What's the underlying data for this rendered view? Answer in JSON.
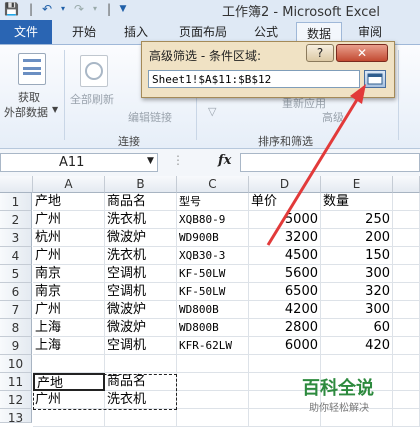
{
  "window": {
    "title": "工作簿2 - Microsoft Excel"
  },
  "quick_access": {
    "icons": [
      "save-icon",
      "undo-icon",
      "redo-icon",
      "customize-icon"
    ]
  },
  "ribbon": {
    "tabs": [
      "文件",
      "开始",
      "插入",
      "页面布局",
      "公式",
      "数据",
      "审阅"
    ],
    "active_tab": "数据",
    "get_external_data": {
      "line1": "获取",
      "line2": "外部数据"
    },
    "refresh_all": "全部刷新",
    "edit_links": "编辑链接",
    "group_connections": "连接",
    "group_sort_filter": "排序和筛选",
    "reapply": "重新应用",
    "advanced": "高级"
  },
  "dialog": {
    "title": "高级筛选 - 条件区域:",
    "help": "?",
    "close": "✕",
    "value": "Sheet1!$A$11:$B$12"
  },
  "formula_bar": {
    "name_box": "A11",
    "fx": "fx",
    "formula": ""
  },
  "sheet": {
    "columns": [
      "A",
      "B",
      "C",
      "D",
      "E"
    ],
    "rows": [
      [
        "产地",
        "商品名",
        "型号",
        "单价",
        "数量"
      ],
      [
        "广州",
        "洗衣机",
        "XQB80-9",
        "5000",
        "250"
      ],
      [
        "杭州",
        "微波炉",
        "WD900B",
        "3200",
        "200"
      ],
      [
        "广州",
        "洗衣机",
        "XQB30-3",
        "4500",
        "150"
      ],
      [
        "南京",
        "空调机",
        "KF-50LW",
        "5600",
        "300"
      ],
      [
        "南京",
        "空调机",
        "KF-50LW",
        "6500",
        "320"
      ],
      [
        "广州",
        "微波炉",
        "WD800B",
        "4200",
        "300"
      ],
      [
        "上海",
        "微波炉",
        "WD800B",
        "2800",
        "60"
      ],
      [
        "上海",
        "空调机",
        "KFR-62LW",
        "6000",
        "420"
      ],
      [
        "",
        "",
        "",
        "",
        ""
      ],
      [
        "产地",
        "商品名",
        "",
        "",
        ""
      ],
      [
        "广州",
        "洗衣机",
        "",
        "",
        ""
      ],
      [
        "",
        "",
        "",
        "",
        ""
      ]
    ],
    "row_numbers": [
      "1",
      "2",
      "3",
      "4",
      "5",
      "6",
      "7",
      "8",
      "9",
      "10",
      "11",
      "12",
      "13"
    ]
  },
  "watermark": {
    "title": "百科全说",
    "subtitle": "助你轻松解决"
  },
  "colors": {
    "file_tab": "#2a65b3",
    "dialog_bg": "#f0e2c4",
    "arrow": "#e23a3a"
  }
}
